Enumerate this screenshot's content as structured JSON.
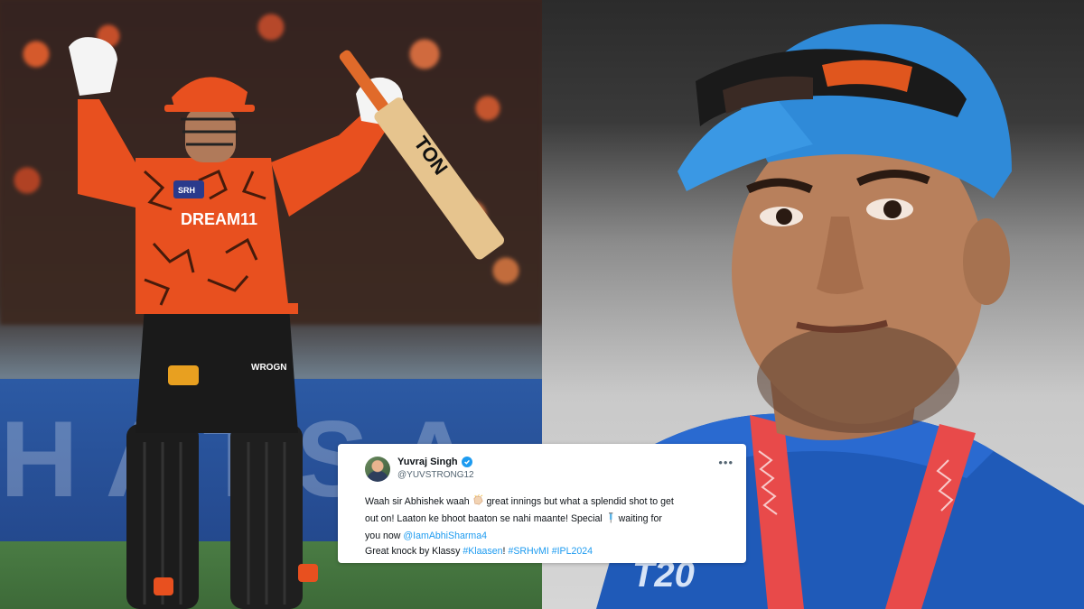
{
  "tweet": {
    "author_name": "Yuvraj Singh",
    "author_handle": "@YUVSTRONG12",
    "verified": true,
    "line1_a": "Waah sir Abhishek waah",
    "line1_b": "great innings but what a splendid shot to get",
    "line2": "out on! Laaton ke bhoot baaton se nahi maante! Special",
    "line3_a": "waiting for",
    "line3_b_prefix": "you now",
    "mention": "@IamAbhiSharma4",
    "line4_prefix": "Great knock by Klassy",
    "hashtag1": "#Klaasen",
    "hashtag1_suffix": "!",
    "hashtag2": "#SRHvMI",
    "hashtag3": "#IPL2024",
    "icons": [
      "clap-emoji-icon",
      "syringe-emoji-icon",
      "verified-badge-icon",
      "more-options-icon"
    ]
  },
  "left_photo": {
    "jersey_sponsor": "DREAM11",
    "bat_brand": "TON",
    "jersey_logo": "SRH",
    "pads_brand": "WROGN",
    "board_text": "HATSA"
  },
  "right_photo": {
    "jersey_text": "T20"
  },
  "colors": {
    "link": "#1d9bf0",
    "text": "#0f1419",
    "muted": "#536471",
    "srh_orange": "#e8501f"
  }
}
